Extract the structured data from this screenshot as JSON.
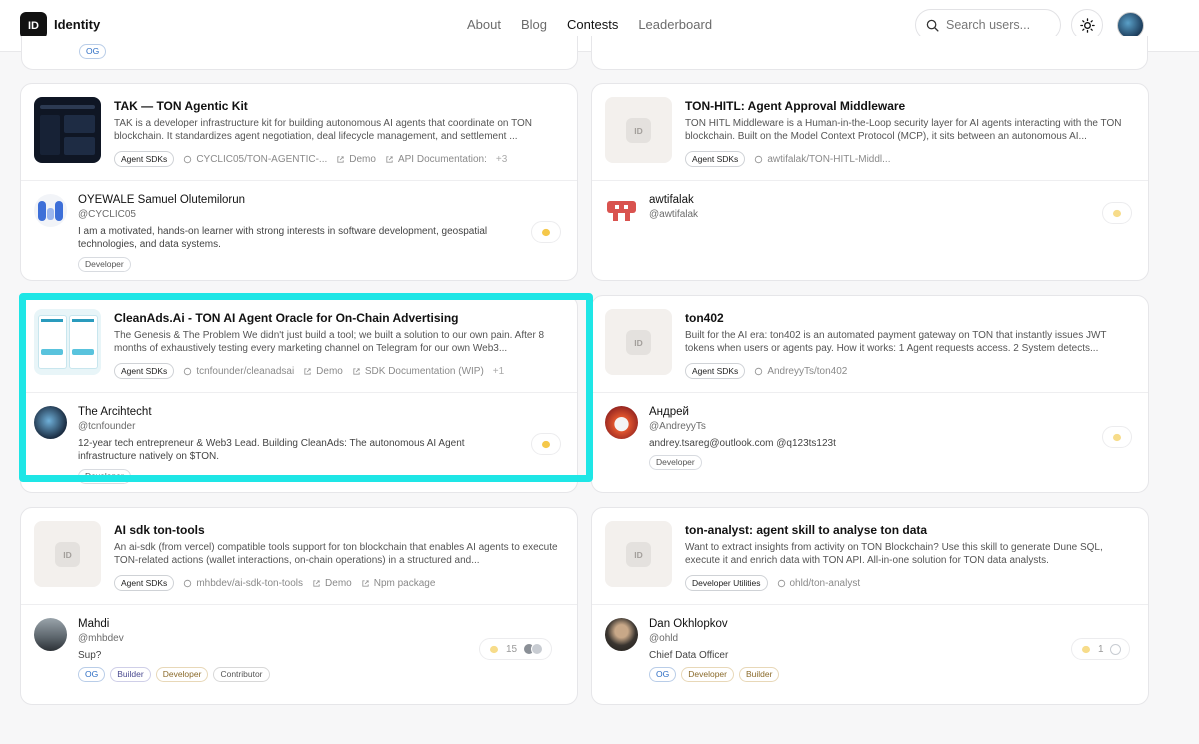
{
  "header": {
    "logo": "ID",
    "brand": "Identity",
    "nav": [
      "About",
      "Blog",
      "Contests",
      "Leaderboard"
    ],
    "active_nav": "Contests",
    "search_placeholder": "Search users..."
  },
  "partial_cards": [
    {
      "tag": "OG"
    }
  ],
  "cards": [
    {
      "title": "TAK — TON Agentic Kit",
      "desc": "TAK is a developer infrastructure kit for building autonomous AI agents that coordinate on TON blockchain. It standardizes agent negotiation, deal lifecycle management, and settlement ...",
      "category": "Agent SDKs",
      "repo": "CYCLIC05/TON-AGENTIC-...",
      "links": [
        "Demo",
        "API Documentation:"
      ],
      "more": "+3",
      "user": {
        "name": "OYEWALE Samuel Olutemilorun",
        "handle": "@CYCLIC05",
        "bio": "I am a motivated, hands-on learner with strong interests in software development, geospatial technologies, and data systems.",
        "tags": [
          "Developer"
        ]
      },
      "reaction": ""
    },
    {
      "title": "TON-HITL: Agent Approval Middleware",
      "desc": "TON HITL Middleware is a Human-in-the-Loop security layer for AI agents interacting with the TON blockchain. Built on the Model Context Protocol (MCP), it sits between an autonomous AI...",
      "category": "Agent SDKs",
      "repo": "awtifalak/TON-HITL-Middl...",
      "links": [],
      "more": "",
      "user": {
        "name": "awtifalak",
        "handle": "@awtifalak",
        "bio": "",
        "tags": []
      },
      "reaction": ""
    },
    {
      "title": "CleanAds.Ai - TON AI Agent Oracle for On-Chain Advertising",
      "desc": "The Genesis & The Problem We didn't just build a tool; we built a solution to our own pain. After 8 months of exhaustively testing every marketing channel on Telegram for our own Web3...",
      "category": "Agent SDKs",
      "repo": "tcnfounder/cleanadsai",
      "links": [
        "Demo",
        "SDK Documentation (WIP)"
      ],
      "more": "+1",
      "user": {
        "name": "The Arcihtecht",
        "handle": "@tcnfounder",
        "bio": "12-year tech entrepreneur & Web3 Lead. Building CleanAds: The autonomous AI Agent infrastructure natively on $TON.",
        "tags": [
          "Developer"
        ]
      },
      "reaction": ""
    },
    {
      "title": "ton402",
      "desc": "Built for the AI era: ton402 is an automated payment gateway on TON that instantly issues JWT tokens when users or agents pay. How it works: 1 Agent requests access. 2 System detects...",
      "category": "Agent SDKs",
      "repo": "AndreyyTs/ton402",
      "links": [],
      "more": "",
      "user": {
        "name": "Андрей",
        "handle": "@AndreyyTs",
        "bio": "andrey.tsareg@outlook.com @q123ts123t",
        "tags": [
          "Developer"
        ]
      },
      "reaction": ""
    },
    {
      "title": "AI sdk ton-tools",
      "desc": "An ai-sdk (from vercel) compatible tools support for ton blockchain that enables AI agents to execute TON-related actions (wallet interactions, on-chain operations) in a structured and...",
      "category": "Agent SDKs",
      "repo": "mhbdev/ai-sdk-ton-tools",
      "links": [
        "Demo",
        "Npm package"
      ],
      "more": "",
      "user": {
        "name": "Mahdi",
        "handle": "@mhbdev",
        "bio": "Sup?",
        "tags": [
          "OG",
          "Builder",
          "Developer",
          "Contributor"
        ]
      },
      "reaction": "15"
    },
    {
      "title": "ton-analyst: agent skill to analyse ton data",
      "desc": "Want to extract insights from activity on TON Blockchain? Use this skill to generate Dune SQL, execute it and enrich data with TON API. All-in-one solution for TON data analysts.",
      "category": "Developer Utilities",
      "repo": "ohld/ton-analyst",
      "links": [],
      "more": "",
      "user": {
        "name": "Dan Okhlopkov",
        "handle": "@ohld",
        "bio": "Chief Data Officer",
        "tags": [
          "OG",
          "Developer",
          "Builder"
        ]
      },
      "reaction": "1"
    }
  ]
}
